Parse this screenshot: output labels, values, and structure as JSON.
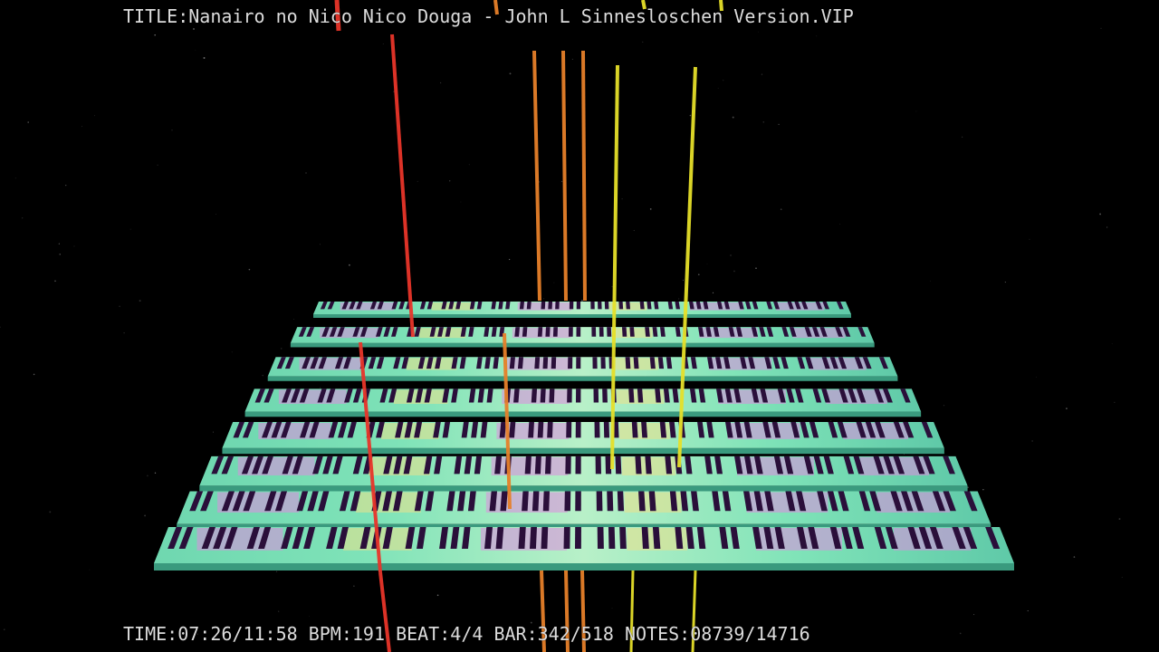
{
  "hud": {
    "title_label": "TITLE:",
    "title_value": "Nanairo no Nico Nico Douga - John L Sinnesloschen Version.VIP",
    "time_label": "TIME:",
    "time_value": "07:26/11:58",
    "bpm_label": "BPM:",
    "bpm_value": "191",
    "beat_label": "BEAT:",
    "beat_value": "4/4",
    "bar_label": "BAR:",
    "bar_value": "342/518",
    "notes_label": "NOTES:",
    "notes_value": "08739/14716"
  },
  "visualizer": {
    "keyboard_rows": 8,
    "playback_progress": 0.62,
    "colors": {
      "background": "#000000",
      "white_key": "#7fe3b8",
      "black_key": "#2a0f3a",
      "highlight_pink": "#e08ae0",
      "highlight_yellow": "#ece08a",
      "note_red": "#e8352a",
      "note_orange": "#e6802a",
      "note_yellow": "#e6e02a"
    }
  }
}
